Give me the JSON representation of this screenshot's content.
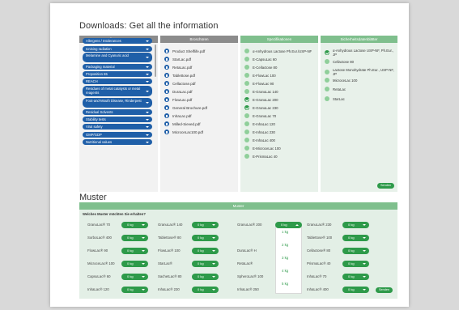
{
  "downloads_title": "Downloads: Get all the information",
  "muster_title": "Muster",
  "columns": {
    "quality": "Quality Statements",
    "brochures": "Broschüren",
    "specifications": "Spezifikationen",
    "certificates": "Sicherheitsdatenblätter"
  },
  "quality_items": [
    "Allergens / Intolerances",
    "Ionising radiation",
    "Melamine and Cyanuric acid",
    "Packaging material",
    "Proposition 65",
    "REACH",
    "Residues of metal catalysts or metal reagents",
    "Foot-and-Mouth Disease, Rinderpest",
    "Residual Solvents",
    "Stability tests",
    "Viral safety",
    "GMP/GDP",
    "Nutritional values"
  ],
  "brochure_items": [
    "Product Shelflife.pdf",
    "StarLac.pdf",
    "RetaLac.pdf",
    "Tablettose.pdf",
    "Cellactose.pdf",
    "DuraLac.pdf",
    "FlowLac.pdf",
    "General Brochure.pdf",
    "InhaLac.pdf",
    "Milled-Sieved.pdf",
    "MicroceLac100.pdf"
  ],
  "spec_items": [
    "α-Anhydrous Lactose Ph.Eur./USP-NF",
    "E-CapsuLac 60",
    "E-Cellactose 80",
    "E-FlowLac 100",
    "E-FlowLac 90",
    "E-GranuLac 140",
    "E-GranuLac 200",
    "E-GranuLac 230",
    "E-GranuLac 70",
    "E-InhaLac 120",
    "E-InhaLac 230",
    "E-InhaLac 400",
    "E-MicroceLac 100",
    "E-PrismaLac 40"
  ],
  "spec_checked": [
    false,
    false,
    false,
    false,
    false,
    false,
    true,
    true,
    false,
    false,
    false,
    false,
    false,
    false
  ],
  "cert_items": [
    "α-Anhydrous Lactose USP-NF, Ph.Eur., JP",
    "Cellactose 80",
    "Lactose Monohydrate Ph.Eur., USP-NF, JP",
    "MicroceLac 100",
    "RetaLac",
    "StarLac"
  ],
  "cert_checked": [
    true,
    false,
    false,
    false,
    false,
    false
  ],
  "send_label": "Senden",
  "muster": {
    "header": "Muster",
    "question": "Welches Muster möchten Sie erhalten?",
    "rows": [
      [
        "GranuLac® 70",
        "GranuLac® 140",
        "GranuLac® 200",
        "GranuLac® 230"
      ],
      [
        "SorboLac® 400",
        "Tablettose® 80",
        "1 kg",
        "Tablettose® 100"
      ],
      [
        "FlowLac® 90",
        "FlowLac® 100",
        "DuraLac® H",
        "Cellactose® 80"
      ],
      [
        "MicroceLac® 100",
        "StarLac®",
        "RetaLac®",
        "PrismaLac® 40"
      ],
      [
        "CapsuLac® 60",
        "SachetLac® 80",
        "SpheroLac® 100",
        "InhaLac® 70"
      ],
      [
        "InhaLac® 120",
        "InhaLac® 230",
        "InhaLac® 250",
        "InhaLac® 400"
      ]
    ],
    "default_qty": "0 kg",
    "dropdown_options": [
      "1 kg",
      "2 kg",
      "3 kg",
      "4 kg",
      "5 kg"
    ],
    "send_label": "Senden"
  }
}
